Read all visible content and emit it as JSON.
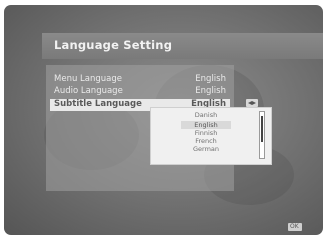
{
  "window": {
    "title": "Language Setting"
  },
  "menu": {
    "items": [
      {
        "label": "Menu Language",
        "value": "English"
      },
      {
        "label": "Audio Language",
        "value": "English"
      },
      {
        "label": "Subtitle Language",
        "value": "English"
      }
    ],
    "selected_index": 2
  },
  "dropdown": {
    "options": [
      "Danish",
      "English",
      "Finnish",
      "French",
      "German"
    ],
    "highlighted": "English"
  },
  "icons": {
    "left_right": "left-right-arrows-icon",
    "ok": "ok-icon"
  },
  "footer": {
    "ok_label": "OK"
  },
  "colors": {
    "title_bar": "#7f7f7f",
    "highlight": "#e9e9e9",
    "dropdown_bg": "#f0f0f0"
  }
}
